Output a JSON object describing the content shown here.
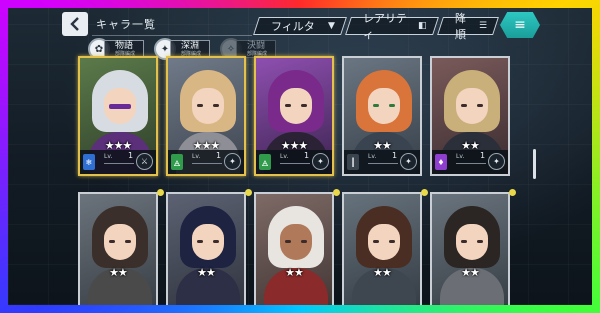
{
  "header": {
    "title": "キャラ一覧",
    "filter_label": "フィルタ",
    "rarity_label": "レアリティ",
    "sort_label": "降順"
  },
  "tabs": [
    {
      "name": "物語",
      "sub": "部隊編成",
      "emblem": "✿"
    },
    {
      "name": "深淵",
      "sub": "部隊編成",
      "emblem": "✦"
    },
    {
      "name": "決闘",
      "sub": "部隊編成",
      "emblem": "✧"
    }
  ],
  "cards": [
    {
      "stars": "★★★",
      "lv_label": "Lv.",
      "lv": "1",
      "frame": "gold",
      "attr": "ice",
      "attr_color": "#2e6fd1",
      "attr_icon": "❄",
      "role_icon": "⚔",
      "hair": "#d7dce2",
      "body": "#5b2f7a",
      "bg": "#3f5f3a"
    },
    {
      "stars": "★★★",
      "lv_label": "Lv.",
      "lv": "1",
      "frame": "gold",
      "attr": "wind",
      "attr_color": "#2f9b4b",
      "attr_icon": "🜁",
      "role_icon": "✦",
      "hair": "#d9b785",
      "body": "#8e8f96",
      "bg": "#5c6473"
    },
    {
      "stars": "★★★",
      "lv_label": "Lv.",
      "lv": "1",
      "frame": "gold",
      "attr": "wind",
      "attr_color": "#2f9b4b",
      "attr_icon": "🜁",
      "role_icon": "✦",
      "hair": "#7a2a8a",
      "body": "#2b2236",
      "bg": "#6b3f86"
    },
    {
      "stars": "★★",
      "lv_label": "Lv.",
      "lv": "1",
      "frame": "silver",
      "attr": "none",
      "attr_color": "#3a444e",
      "attr_icon": "┃",
      "role_icon": "✦",
      "hair": "#d9743a",
      "body": "#3a4350",
      "bg": "#4e5a66"
    },
    {
      "stars": "★★",
      "lv_label": "Lv.",
      "lv": "1",
      "frame": "silver",
      "attr": "dark",
      "attr_color": "#8e3fd0",
      "attr_icon": "♦",
      "role_icon": "✦",
      "hair": "#c9b07a",
      "body": "#2a2f3a",
      "bg": "#5a4444"
    },
    {
      "stars": "★★",
      "frame": "silver",
      "hair": "#3a2f2a",
      "body": "#4a4a4a",
      "bg": "#525a62"
    },
    {
      "stars": "★★",
      "frame": "silver",
      "hair": "#1d2340",
      "body": "#2c2f45",
      "bg": "#4a5060"
    },
    {
      "stars": "★★",
      "frame": "silver",
      "hair": "#e8e4e0",
      "body": "#8a2a2a",
      "bg": "#6a5a58"
    },
    {
      "stars": "★★",
      "frame": "silver",
      "hair": "#4a2e24",
      "body": "#3e4650",
      "bg": "#54606a"
    },
    {
      "stars": "★★",
      "frame": "silver",
      "hair": "#2b2623",
      "body": "#6b6f75",
      "bg": "#5c6670"
    }
  ],
  "colors": {
    "accent": "#2ec7c2",
    "gold": "#e4c14a",
    "notify_dot": "#e8d84a"
  }
}
